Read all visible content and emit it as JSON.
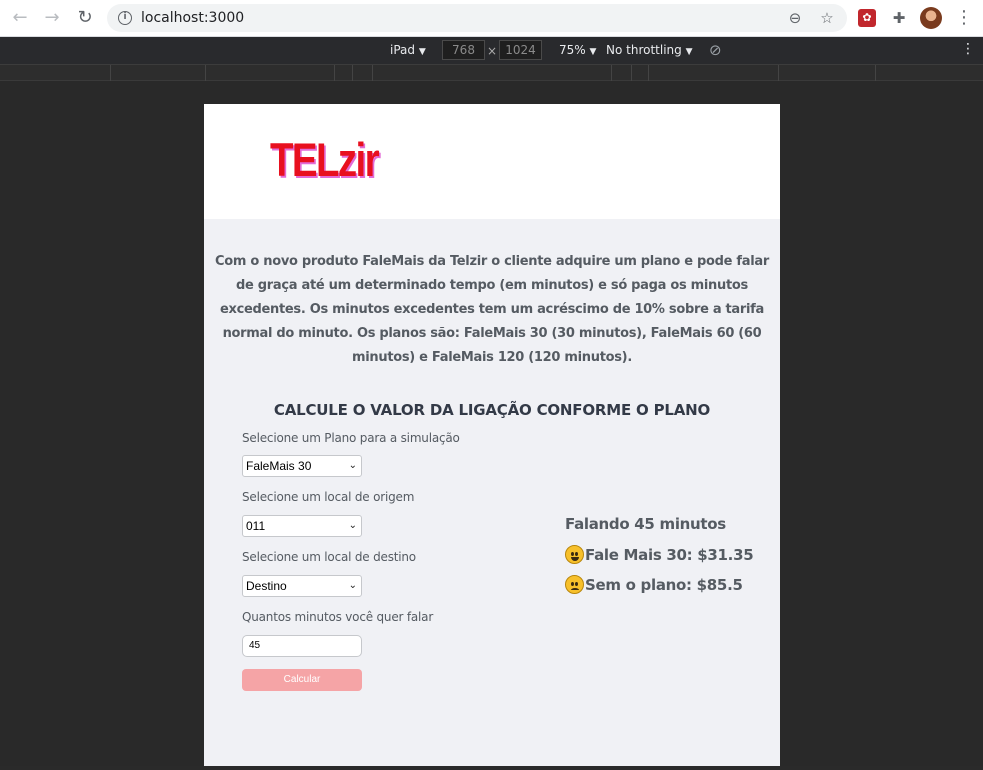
{
  "browser": {
    "url": "localhost:3000",
    "icons": {
      "back": "arrow-left-icon",
      "forward": "arrow-right-icon",
      "reload": "reload-icon",
      "info": "info-icon",
      "zoom": "zoom-out-icon",
      "bookmark": "star-icon",
      "extensions": "puzzle-icon",
      "menu": "kebab-menu-icon"
    }
  },
  "devtools": {
    "device": "iPad",
    "width": "768",
    "height": "1024",
    "times": "×",
    "zoom": "75%",
    "throttling": "No throttling",
    "dropdown_arrow": "▼"
  },
  "page": {
    "logo": "TELzir",
    "intro": "Com o novo produto FaleMais da Telzir o cliente adquire um plano e pode falar de graça até um determinado tempo (em minutos) e só paga os minutos excedentes. Os minutos excedentes tem um acréscimo de 10% sobre a tarifa normal do minuto. Os planos são: FaleMais 30 (30 minutos), FaleMais 60 (60 minutos) e FaleMais 120 (120 minutos).",
    "calc_title": "CALCULE O VALOR DA LIGAÇÃO CONFORME O PLANO",
    "form": {
      "plan_label": "Selecione um Plano para a simulação",
      "plan_value": "FaleMais 30",
      "origin_label": "Selecione um local de origem",
      "origin_value": "011",
      "destination_label": "Selecione um local de destino",
      "destination_value": "Destino",
      "minutes_label": "Quantos minutos você quer falar",
      "minutes_value": "45",
      "calculate_button": "Calcular"
    },
    "result": {
      "title": "Falando 45 minutos",
      "with_plan": "Fale Mais 30: $31.35",
      "without_plan": "Sem o plano: $85.5"
    }
  },
  "colors": {
    "logo": "#e8101f",
    "button": "#f5a4a6",
    "page_background": "#f0f1f5"
  }
}
